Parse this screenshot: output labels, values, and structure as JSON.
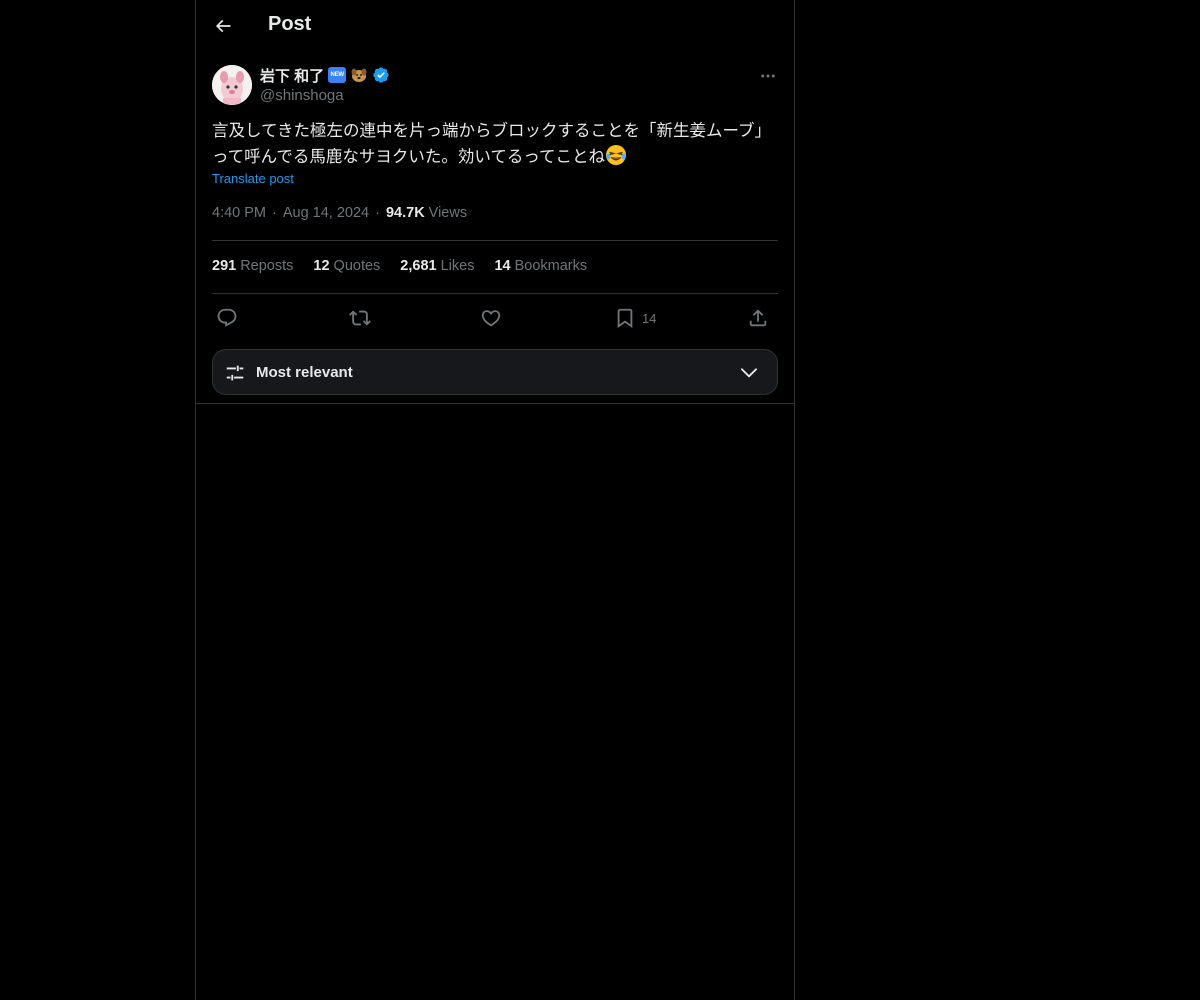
{
  "header": {
    "title": "Post",
    "back_icon": "arrow-left-icon"
  },
  "post": {
    "author": {
      "display_name": "岩下 和了",
      "badge_new": "NEW",
      "handle": "@shinshoga",
      "verified": true
    },
    "text": "言及してきた極左の連中を片っ端からブロックすることを「新生姜ムーブ」って呼んでる馬鹿なサヨクいた。効いてるってことね",
    "translate_label": "Translate post",
    "time": "4:40 PM",
    "date": "Aug 14, 2024",
    "separator": "·",
    "views_count": "94.7K",
    "views_label": "Views"
  },
  "stats": [
    {
      "count": "291",
      "label": "Reposts"
    },
    {
      "count": "12",
      "label": "Quotes"
    },
    {
      "count": "2,681",
      "label": "Likes"
    },
    {
      "count": "14",
      "label": "Bookmarks"
    }
  ],
  "actions": {
    "reply_icon": "reply-icon",
    "repost_icon": "repost-icon",
    "like_icon": "heart-icon",
    "bookmark_icon": "bookmark-icon",
    "bookmark_count": "14",
    "share_icon": "share-icon"
  },
  "sort": {
    "label": "Most relevant"
  },
  "colors": {
    "background": "#000000",
    "text": "#e7e9ea",
    "muted": "#71767b",
    "accent": "#1d9bf0",
    "border": "#2f3336",
    "verified": "#1d9bf0"
  }
}
